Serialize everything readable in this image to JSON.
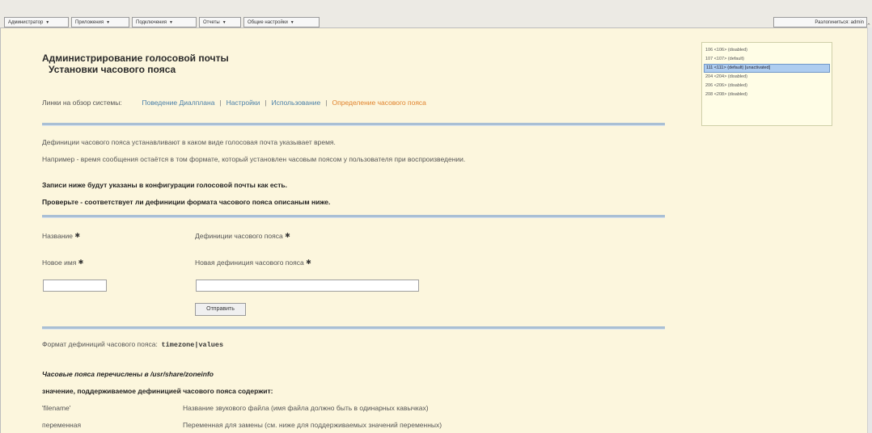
{
  "nav": {
    "menus": [
      {
        "label": "Администратор"
      },
      {
        "label": "Приложения"
      },
      {
        "label": "Подключения"
      },
      {
        "label": "Отчеты"
      },
      {
        "label": "Общие настройки"
      }
    ],
    "caret": "▼",
    "logout_label": "Разлогиниться: admin"
  },
  "extensions": [
    {
      "label": "106 <106> (disabled)",
      "selected": false
    },
    {
      "label": "107 <107> (default)",
      "selected": false
    },
    {
      "label": "111 <111> (default) [unactivated]",
      "selected": true
    },
    {
      "label": "204 <204> (disabled)",
      "selected": false
    },
    {
      "label": "206 <206> (disabled)",
      "selected": false
    },
    {
      "label": "208 <208> (disabled)",
      "selected": false
    }
  ],
  "page": {
    "title": "Администрирование голосовой почты",
    "subtitle": "Установки часового пояса"
  },
  "links": {
    "prefix": "Линки на обзор системы:",
    "items": [
      {
        "label": "Поведение Диалплана"
      },
      {
        "label": "Настройки"
      },
      {
        "label": "Использование"
      },
      {
        "label": "Определение часового пояса"
      }
    ],
    "separator": "|"
  },
  "intro": {
    "line1": "Дефиниции часового пояса устанавливают в каком виде голосовая почта указывает время.",
    "line2": "Например - время сообщения остаётся в том формате, который установлен часовым поясом у пользователя при воспроизведении.",
    "bold1": "Записи ниже будут указаны в конфигурации голосовой почты как есть.",
    "bold2": "Проверьте - соответствует ли дефиниции формата часового пояса описаным ниже."
  },
  "form": {
    "name_label": "Название",
    "definition_label": "Дефиниции часового пояса",
    "new_name_label": "Новое имя",
    "new_definition_label": "Новая дефиниция часового пояса",
    "required_mark": "✱",
    "new_name_value": "",
    "new_definition_value": "",
    "submit_label": "Отправить"
  },
  "format": {
    "label": "Формат дефиниций часового пояса:",
    "value": "timezone|values",
    "zones_note_prefix": "Часовые пояса перечислены в",
    "zones_note_path": "/usr/share/zoneinfo",
    "supported_heading": "значение, поддерживаемое дефиницией часового пояса содержит:",
    "rows": [
      {
        "key": "'filename'",
        "desc": "Название звукового файла (имя файла должно быть в одинарных кавычках)"
      },
      {
        "key": "переменная",
        "desc": "Переменная для замены (см. ниже для поддерживаемых значений переменных)"
      }
    ]
  }
}
